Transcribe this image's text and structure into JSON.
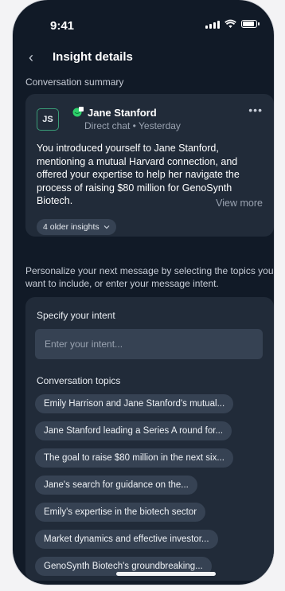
{
  "status_bar": {
    "time": "9:41"
  },
  "header": {
    "title": "Insight details"
  },
  "summary": {
    "section_label": "Conversation summary",
    "avatar_initials": "JS",
    "name": "Jane Stanford",
    "meta": "Direct chat • Yesterday",
    "text": "You introduced yourself to Jane Stanford, mentioning a mutual Harvard connection, and offered your expertise to help her navigate the process of raising $80 million for GenoSynth Biotech.",
    "view_more": "View more",
    "older_insights": "4 older insights"
  },
  "prompt": "Personalize your next message by selecting the topics you want to include, or enter your message intent.",
  "intent": {
    "label": "Specify your intent",
    "placeholder": "Enter your intent..."
  },
  "topics": {
    "label": "Conversation topics",
    "items": [
      "Emily Harrison and Jane Stanford's mutual...",
      "Jane Stanford leading a Series A round for...",
      "The goal to raise $80 million in the next six...",
      "Jane's search for guidance on the...",
      "Emily's expertise in the biotech sector",
      "Market dynamics and effective investor...",
      "GenoSynth Biotech's groundbreaking..."
    ]
  },
  "colors": {
    "background": "#111a27",
    "card": "#212b39",
    "chip": "#364253",
    "accent": "#3a9c77"
  }
}
